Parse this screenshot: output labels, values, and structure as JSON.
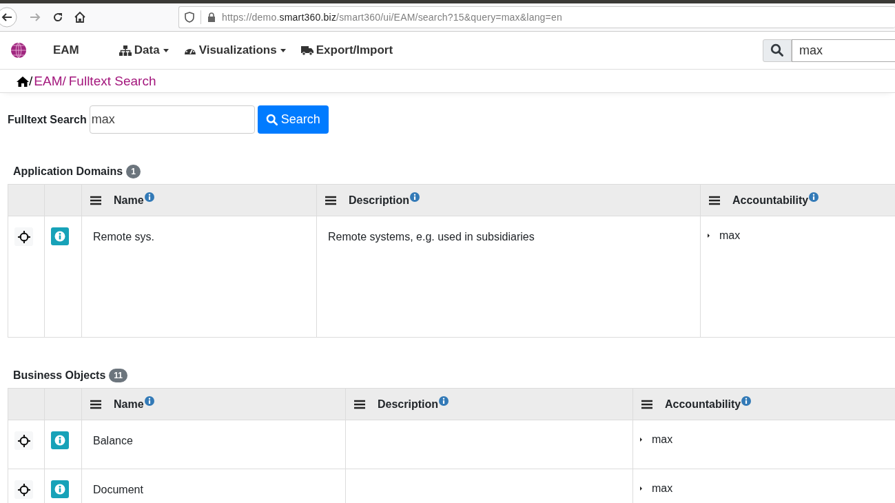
{
  "browser": {
    "url": {
      "before": "https://demo.",
      "domain": "smart360.biz",
      "after": "/smart360/ui/EAM/search?15&query=max&lang=en"
    }
  },
  "navbar": {
    "brand": "EAM",
    "items": [
      {
        "label": "Data",
        "kind": "dropdown"
      },
      {
        "label": "Visualizations",
        "kind": "dropdown"
      },
      {
        "label": "Export/Import",
        "kind": "link"
      }
    ],
    "search": {
      "value": "max"
    }
  },
  "breadcrumb": [
    {
      "text": "/",
      "kind": "separator"
    },
    {
      "text": "EAM/",
      "kind": "link"
    },
    {
      "text": "Fulltext Search",
      "kind": "link"
    }
  ],
  "search_form": {
    "label": "Fulltext Search",
    "value": "max",
    "button": "Search"
  },
  "sections": [
    {
      "title": "Application Domains",
      "count": "1",
      "columns": [
        "Name",
        "Description",
        "Accountability"
      ],
      "rows": [
        {
          "name": "Remote sys.",
          "description": "Remote systems, e.g. used in subsidiaries",
          "accountability": [
            "max"
          ]
        }
      ]
    },
    {
      "title": "Business Objects",
      "count": "11",
      "columns": [
        "Name",
        "Description",
        "Accountability"
      ],
      "rows": [
        {
          "name": "Balance",
          "description": "",
          "accountability": [
            "max"
          ]
        },
        {
          "name": "Document",
          "description": "",
          "accountability": [
            "max"
          ]
        }
      ]
    }
  ]
}
